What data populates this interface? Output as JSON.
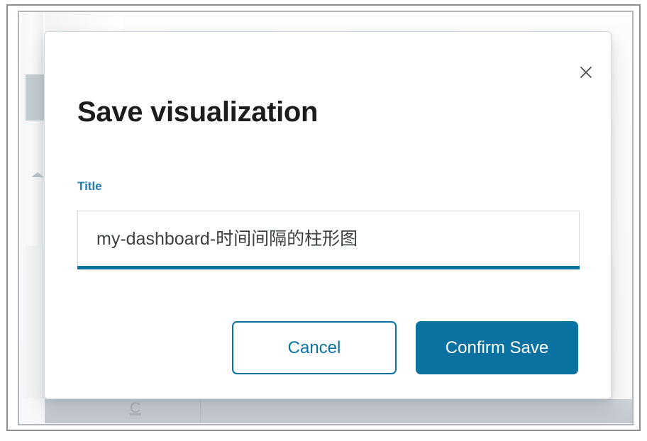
{
  "modal": {
    "title": "Save visualization",
    "close_icon": "close-icon",
    "close_label": "×",
    "field": {
      "label": "Title",
      "value": "my-dashboard-时间间隔的柱形图",
      "placeholder": "",
      "underline_color": "#0a72a0",
      "caret_visible": true
    },
    "actions": {
      "cancel_label": "Cancel",
      "confirm_label": "Confirm Save"
    }
  },
  "background": {
    "scrollbar": {
      "name": "vertical-scrollbar",
      "thumb_name": "scrollbar-thumb",
      "caret_name": "scroll-up-caret-icon"
    },
    "bottom_band": {
      "glyph": "C"
    }
  },
  "colors": {
    "accent": "#0a72a0",
    "label_blue": "#1f7cb4",
    "title_text": "#1a1c1e",
    "input_text": "#3b4045",
    "modal_bg": "#ffffff",
    "page_bg": "#fbfcfc",
    "frame_outer_border": "#8c8f94",
    "frame_inner_border": "#b3b6bb",
    "band_bg": "#c6ccd2"
  }
}
